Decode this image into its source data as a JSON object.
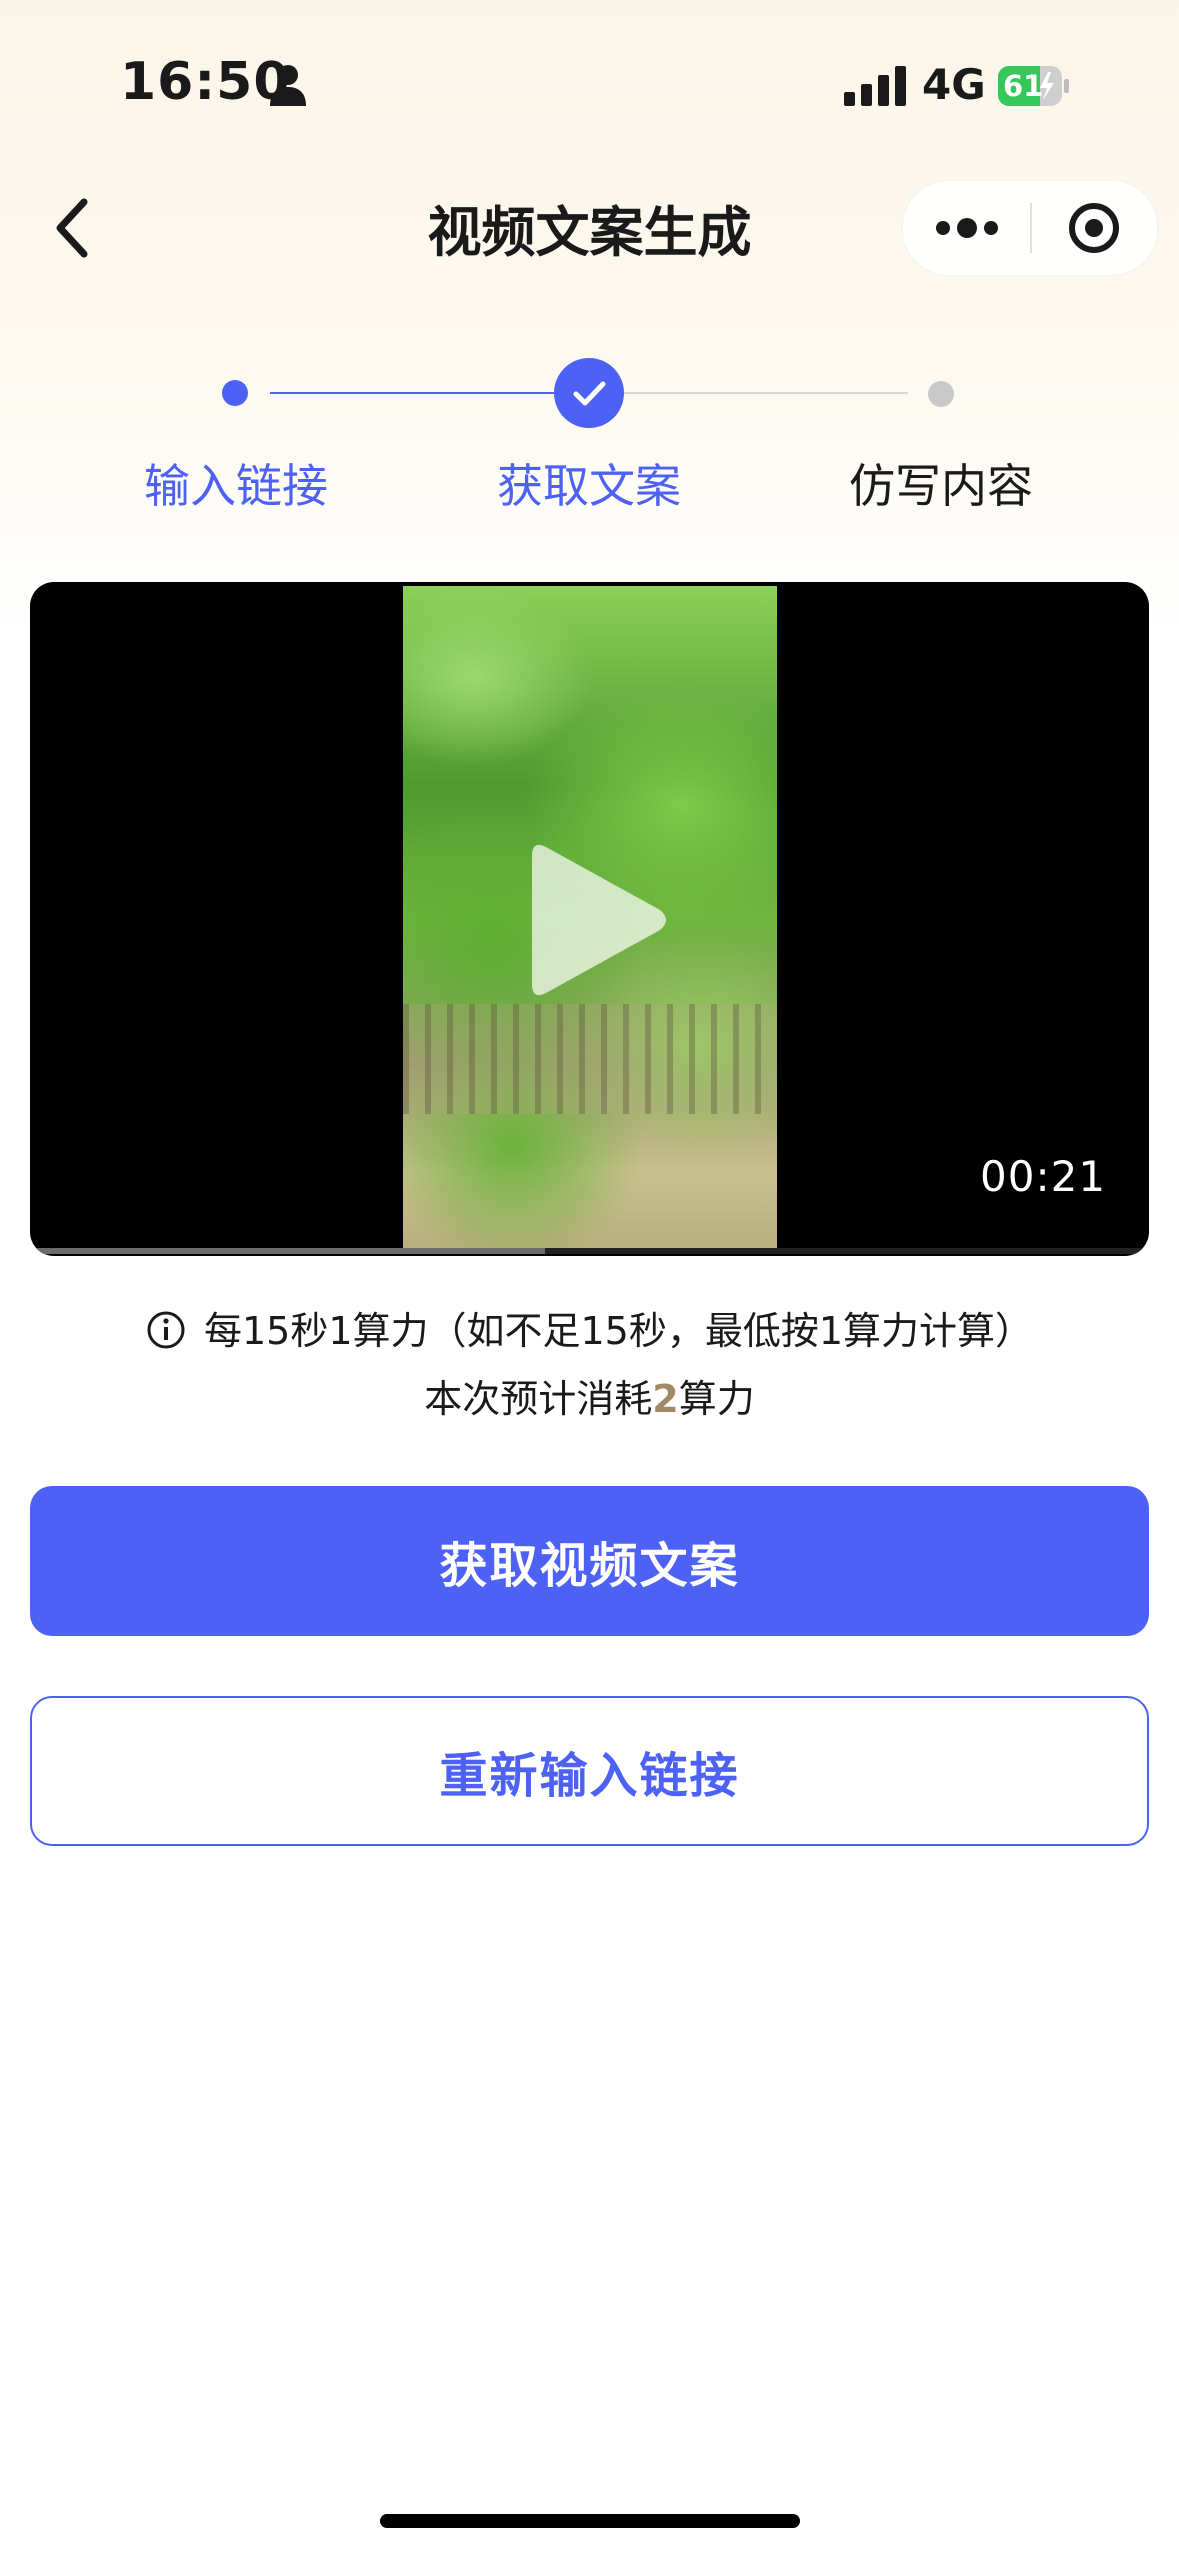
{
  "status_bar": {
    "time": "16:50",
    "network": "4G",
    "battery_level": "61"
  },
  "nav": {
    "title": "视频文案生成"
  },
  "stepper": {
    "steps": [
      {
        "label": "输入链接",
        "state": "done"
      },
      {
        "label": "获取文案",
        "state": "current"
      },
      {
        "label": "仿写内容",
        "state": "pending"
      }
    ]
  },
  "video": {
    "duration": "00:21",
    "progress": 0.46
  },
  "info": {
    "rule_text": "每15秒1算力（如不足15秒，最低按1算力计算）",
    "cost_prefix": "本次预计消耗",
    "cost_value": "2",
    "cost_suffix": "算力"
  },
  "actions": {
    "primary_label": "获取视频文案",
    "secondary_label": "重新输入链接"
  },
  "colors": {
    "accent": "#4d62f5",
    "cost_highlight": "#a08a66",
    "battery": "#34c759"
  }
}
